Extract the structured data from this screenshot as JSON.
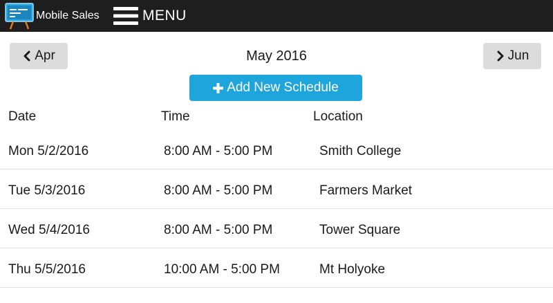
{
  "app": {
    "name": "Mobile Sales",
    "menu_label": "MENU"
  },
  "calendar": {
    "prev_label": "Apr",
    "next_label": "Jun",
    "current_month": "May 2016",
    "add_button_label": "Add New Schedule"
  },
  "table": {
    "headers": {
      "date": "Date",
      "time": "Time",
      "location": "Location"
    },
    "rows": [
      {
        "date": "Mon 5/2/2016",
        "time": "8:00 AM - 5:00 PM",
        "location": "Smith College"
      },
      {
        "date": "Tue 5/3/2016",
        "time": "8:00 AM - 5:00 PM",
        "location": "Farmers Market"
      },
      {
        "date": "Wed 5/4/2016",
        "time": "8:00 AM - 5:00 PM",
        "location": "Tower Square"
      },
      {
        "date": "Thu 5/5/2016",
        "time": "10:00 AM - 5:00 PM",
        "location": "Mt Holyoke"
      }
    ]
  },
  "colors": {
    "topbar": "#1e1e1e",
    "accent": "#1ea5dc",
    "nav_button": "#dcdcdc"
  }
}
